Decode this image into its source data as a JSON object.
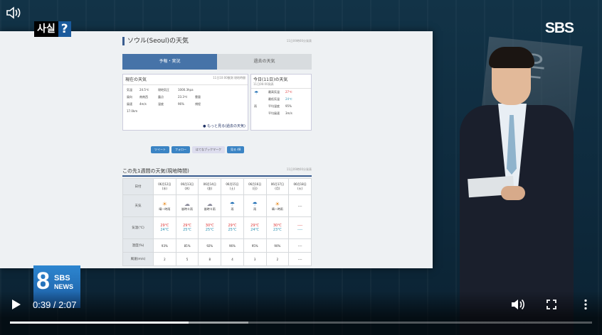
{
  "overlay": {
    "fact_badge_text": "사실",
    "fact_badge_mark": "?",
    "channel_logo": "SBS",
    "news8_number": "8",
    "news8_sbs": "SBS",
    "news8_news": "NEWS",
    "poster_text": "실은"
  },
  "webpage": {
    "title": "ソウル(Seoul)の天気",
    "title_stamp": "11日09時00分発表",
    "tabs": [
      "予報・実況",
      "過去の天気"
    ],
    "current": {
      "heading": "現在の天気",
      "stamp": "11日10:00観測 現地時間",
      "cells": [
        "気温",
        "24.5℃",
        "現地気圧",
        "1000.3hpa",
        "",
        "風向",
        "南南西",
        "露点",
        "23.3℃",
        "雲量",
        "風速",
        "4m/s",
        "湿度",
        "96%",
        "視程",
        "17.0km"
      ],
      "more_link": "もっと見る(過去の天気)"
    },
    "today": {
      "heading": "今日(11日)の天気",
      "stamp": "11日06:00発表",
      "weather": "雨",
      "rows": [
        "最高気温",
        "27℃",
        "最低気温",
        "24℃",
        "平均湿度",
        "95%",
        "平均風速",
        "3m/s"
      ]
    },
    "share_buttons": [
      "ツイート",
      "フォロー",
      "はてなブックマーク",
      "見る 48"
    ]
  },
  "week": {
    "title": "この先1週間の天気(現地時間)",
    "stamp": "11日09時00分発表",
    "labels": {
      "date": "日付",
      "weather": "天気",
      "temp": "気温(℃)",
      "humidity": "湿度(%)",
      "wind": "風速(m/s)"
    },
    "days": [
      {
        "date": "06月12日",
        "dow": "(水)",
        "weather": "晴一時雨",
        "icon": "☀",
        "hi": "29℃",
        "lo": "24℃",
        "hum": "93%",
        "wind": "2"
      },
      {
        "date": "06月13日",
        "dow": "(木)",
        "weather": "曇時々雨",
        "icon": "☁",
        "hi": "29℃",
        "lo": "25℃",
        "hum": "85%",
        "wind": "5"
      },
      {
        "date": "06月14日",
        "dow": "(金)",
        "weather": "曇時々雨",
        "icon": "☁",
        "hi": "30℃",
        "lo": "25℃",
        "hum": "92%",
        "wind": "8"
      },
      {
        "date": "06月15日",
        "dow": "(土)",
        "weather": "雨",
        "icon": "☂",
        "hi": "29℃",
        "lo": "25℃",
        "hum": "96%",
        "wind": "4"
      },
      {
        "date": "06月16日",
        "dow": "(日)",
        "weather": "雨",
        "icon": "☂",
        "hi": "29℃",
        "lo": "24℃",
        "hum": "95%",
        "wind": "3"
      },
      {
        "date": "06月17日",
        "dow": "(月)",
        "weather": "晴一時雨",
        "icon": "☀",
        "hi": "30℃",
        "lo": "23℃",
        "hum": "90%",
        "wind": "2"
      },
      {
        "date": "06月18日",
        "dow": "(火)",
        "weather": "----",
        "icon": "",
        "hi": "----",
        "lo": "----",
        "hum": "----",
        "wind": "----"
      }
    ]
  },
  "controls": {
    "time": "0:39 / 2:07",
    "played_fraction": 0.307,
    "buffered_fraction": 0.41
  }
}
